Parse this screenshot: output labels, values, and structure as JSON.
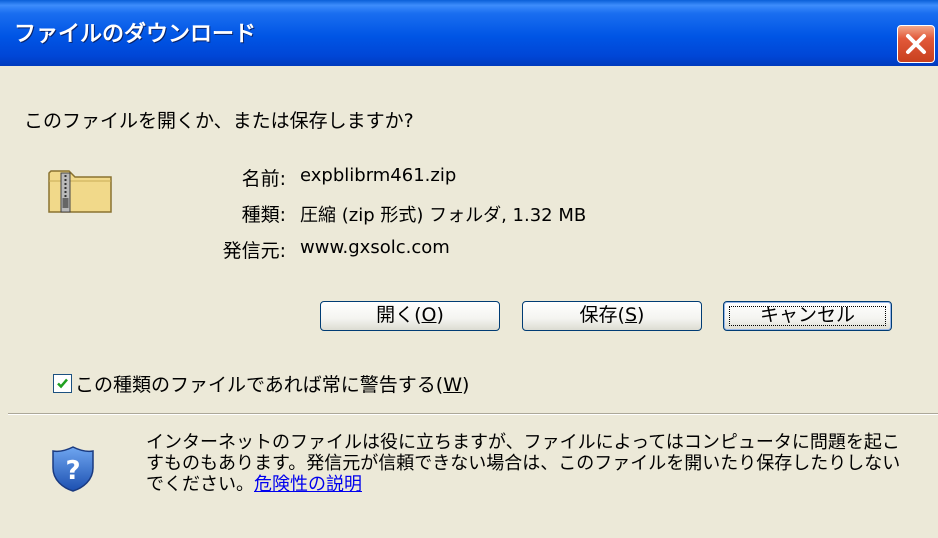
{
  "dialog": {
    "title": "ファイルのダウンロード",
    "question": "このファイルを開くか、または保存しますか?"
  },
  "file": {
    "name_label": "名前:",
    "name": "expblibrm461.zip",
    "type_label": "種類:",
    "type": "圧縮 (zip 形式) フォルダ, 1.32 MB",
    "from_label": "発信元:",
    "from": "www.gxsolc.com"
  },
  "buttons": {
    "open_label": "開く(",
    "open_key": "O",
    "open_end": ")",
    "save_label": "保存(",
    "save_key": "S",
    "save_end": ")",
    "cancel_label": "キャンセル"
  },
  "checkbox": {
    "checked": true,
    "label_text": "この種類のファイルであれば常に警告する(",
    "label_key": "W",
    "label_end": ")"
  },
  "warning": {
    "text": "インターネットのファイルは役に立ちますが、ファイルによってはコンピュータに問題を起こすものもあります。発信元が信頼できない場合は、このファイルを開いたり保存したりしないでください。",
    "link": "危険性の説明"
  },
  "colors": {
    "title_bar": "#0055e5",
    "dialog_bg": "#ece9d8",
    "close_button": "#e2593a",
    "link": "#0000ee"
  },
  "icons": {
    "file": "zip-folder-icon",
    "warning": "shield-question-icon",
    "close": "close-icon",
    "check": "checkmark-icon"
  }
}
